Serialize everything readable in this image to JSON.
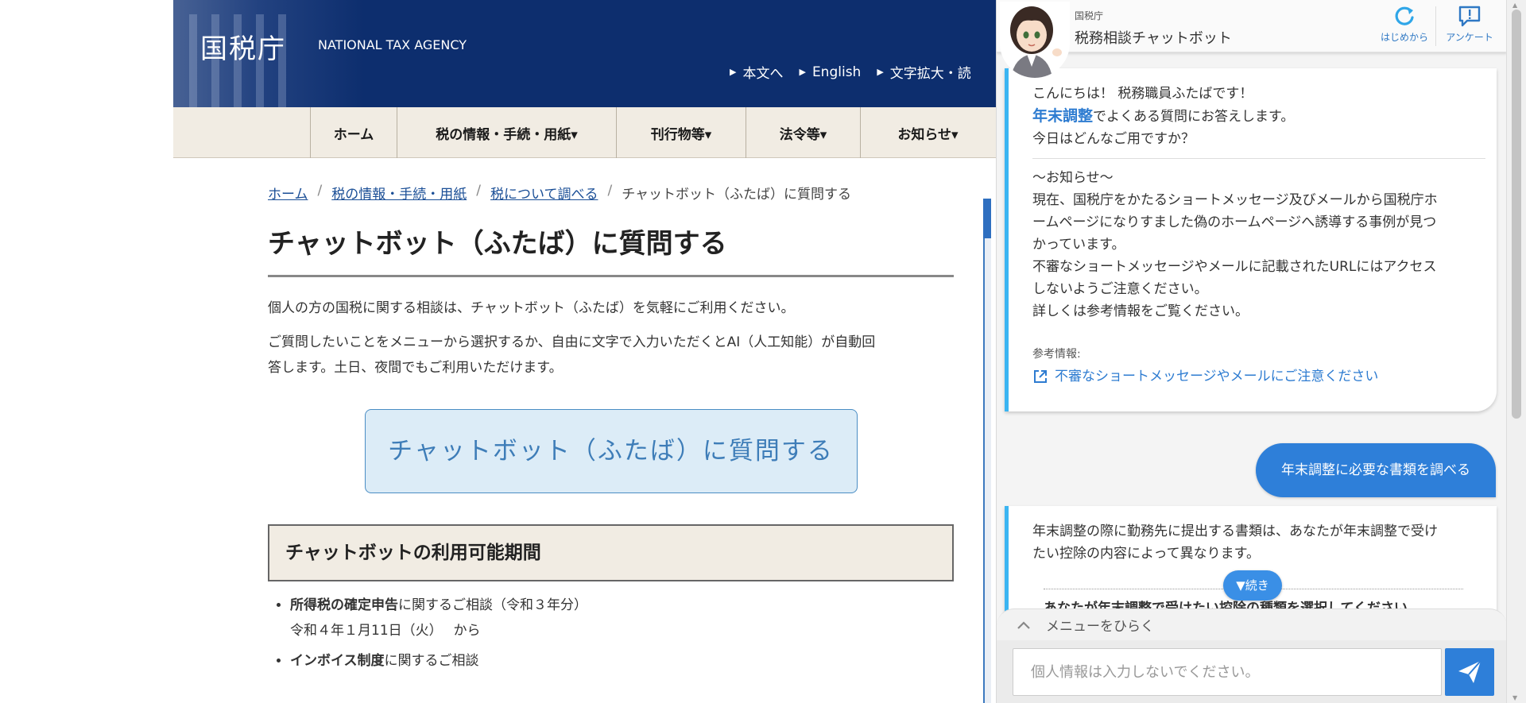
{
  "header": {
    "logo": "国税庁",
    "logo_sub": "NATIONAL TAX AGENCY",
    "util_links": [
      "本文へ",
      "English",
      "文字拡大・読"
    ]
  },
  "nav": [
    "ホーム",
    "税の情報・手続・用紙▾",
    "刊行物等▾",
    "法令等▾",
    "お知らせ▾"
  ],
  "breadcrumb": [
    "ホーム",
    "税の情報・手続・用紙",
    "税について調べる",
    "チャットボット（ふたば）に質問する"
  ],
  "main": {
    "title": "チャットボット（ふたば）に質問する",
    "lead1": "個人の方の国税に関する相談は、チャットボット（ふたば）を気軽にご利用ください。",
    "lead2_line1": "ご質問したいことをメニューから選択するか、自由に文字で入力いただくとAI（人工知能）が自動回",
    "lead2_line2": "答します。土日、夜間でもご利用いただけます。",
    "cta": "チャットボット（ふたば）に質問する",
    "section_title": "チャットボットの利用可能期間",
    "items": [
      {
        "bold": "所得税の確定申告",
        "rest": "に関するご相談（令和３年分）",
        "sub": "令和４年１月11日（火）　 から"
      },
      {
        "bold": "インボイス制度",
        "rest": "に関するご相談",
        "sub": ""
      }
    ]
  },
  "chat": {
    "org": "国税庁",
    "title": "税務相談チャットボット",
    "restart_label": "はじめから",
    "survey_label": "アンケート",
    "greeting": "こんにちは！ 税務職員ふたばです！",
    "topic": "年末調整",
    "topic_rest": "でよくある質問にお答えします。",
    "ask": "今日はどんなご用ですか？",
    "notice_title": "～お知らせ～",
    "notice_1": "現在、国税庁をかたるショートメッセージ及びメールから国税庁ホ",
    "notice_2": "ームページになりすました偽のホームページへ誘導する事例が見つ",
    "notice_3": "かっています。",
    "notice_4": "不審なショートメッセージやメールに記載されたURLにはアクセス",
    "notice_5": "しないようご注意ください。",
    "notice_6": "詳しくは参考情報をご覧ください。",
    "ref_label": "参考情報:",
    "ref_link": "不審なショートメッセージやメールにご注意ください",
    "user_msg": "年末調整に必要な書類を調べる",
    "reply_1": "年末調整の際に勤務先に提出する書類は、あなたが年末調整で受け",
    "reply_2": "たい控除の内容によって異なります。",
    "reply_cut": "あなたが年末調整で受けたい控除の種類を選択してください",
    "more": "▼続き",
    "menu": "メニューをひらく",
    "input_placeholder": "個人情報は入力しないでください。"
  }
}
